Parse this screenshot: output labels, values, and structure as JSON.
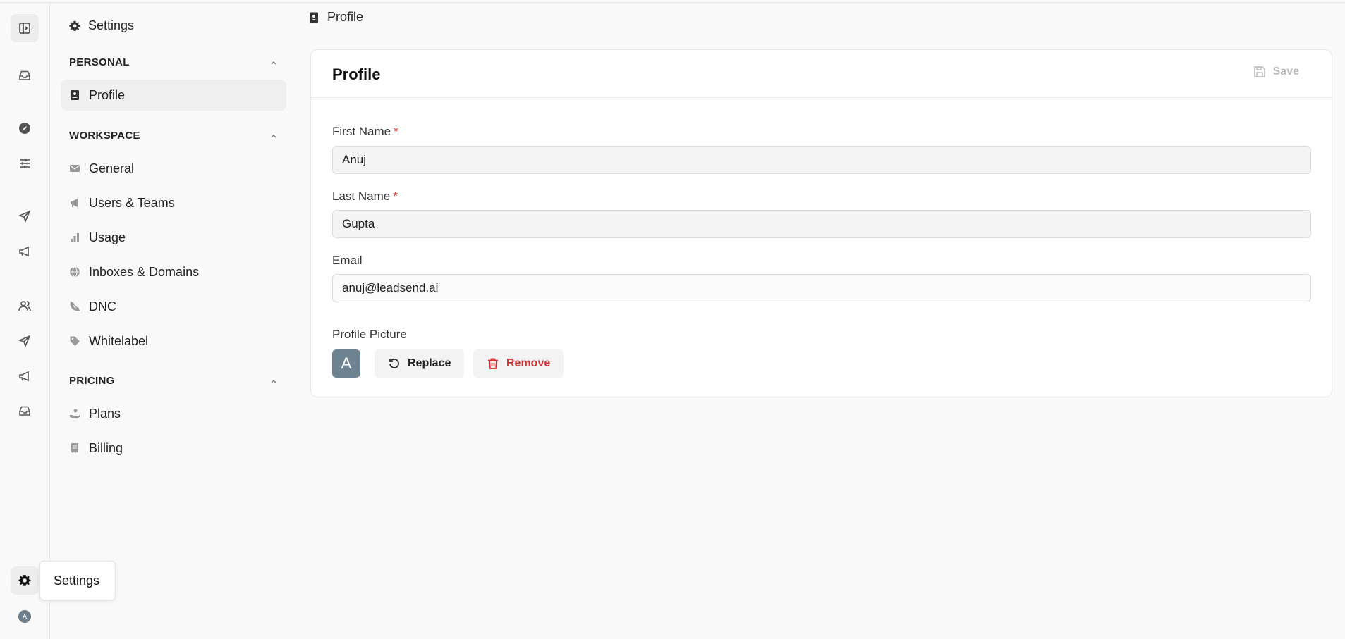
{
  "rail": {
    "tooltip": "Settings",
    "avatar_initial": "A",
    "icons": [
      "sidebar-toggle-icon",
      "inbox-icon",
      "compass-icon",
      "sliders-icon",
      "send-icon",
      "megaphone-icon",
      "users-icon",
      "send-icon",
      "megaphone-icon",
      "inbox-icon",
      "gear-icon"
    ]
  },
  "nav": {
    "title": "Settings",
    "sections": {
      "personal": "PERSONAL",
      "workspace": "WORKSPACE",
      "pricing": "PRICING"
    },
    "items": {
      "profile": "Profile",
      "general": "General",
      "users_teams": "Users & Teams",
      "usage": "Usage",
      "inboxes_domains": "Inboxes & Domains",
      "dnc": "DNC",
      "whitelabel": "Whitelabel",
      "plans": "Plans",
      "billing": "Billing"
    }
  },
  "breadcrumb": "Profile",
  "card": {
    "title": "Profile",
    "save_label": "Save",
    "first_name_label": "First Name",
    "first_name_value": "Anuj",
    "last_name_label": "Last Name",
    "last_name_value": "Gupta",
    "email_label": "Email",
    "email_value": "anuj@leadsend.ai",
    "required_mark": "*",
    "picture_label": "Profile Picture",
    "avatar_initial": "A",
    "replace_label": "Replace",
    "remove_label": "Remove"
  },
  "colors": {
    "accent_required": "#dd2222",
    "remove_red": "#d03030",
    "avatar_bg": "#6d8392"
  }
}
